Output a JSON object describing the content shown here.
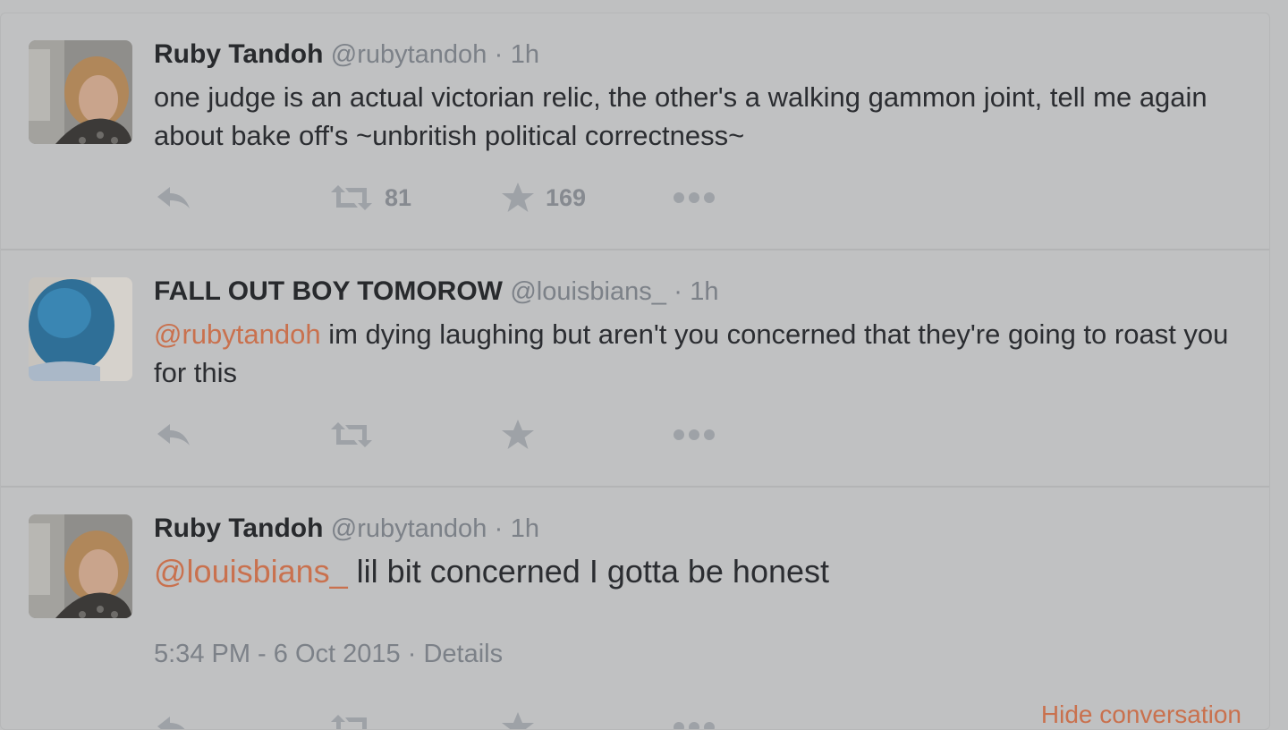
{
  "tweets": [
    {
      "fullname": "Ruby Tandoh",
      "username": "@rubytandoh",
      "separator": "·",
      "time": "1h",
      "text": "one judge is an actual victorian relic, the other's a walking gammon joint, tell me again about bake off's ~unbritish political correctness~",
      "retweet_count": "81",
      "favorite_count": "169",
      "avatar_icon": "avatar-photo-curly-hair"
    },
    {
      "fullname": "FALL OUT BOY TOMOROW",
      "username": "@louisbians_",
      "separator": "·",
      "time": "1h",
      "mention": "@rubytandoh",
      "text": " im dying laughing but aren't you concerned that they're going to roast you for this",
      "avatar_icon": "avatar-photo-blue-hair"
    },
    {
      "fullname": "Ruby Tandoh",
      "username": "@rubytandoh",
      "separator": "·",
      "time": "1h",
      "mention": "@louisbians_",
      "text": " lil bit concerned I gotta be honest",
      "timestamp": "5:34 PM - 6 Oct 2015",
      "meta_separator": "·",
      "details_label": "Details",
      "hide_conversation_label": "Hide conversation",
      "avatar_icon": "avatar-photo-curly-hair"
    }
  ],
  "icons": {
    "reply": "reply-icon",
    "retweet": "retweet-icon",
    "favorite": "star-icon",
    "more": "more-dots-icon"
  },
  "colors": {
    "background": "#c0c1c2",
    "text": "#2b2d31",
    "secondary": "#7c8188",
    "link": "#c9714e",
    "action_icon": "#9ea2a7"
  }
}
